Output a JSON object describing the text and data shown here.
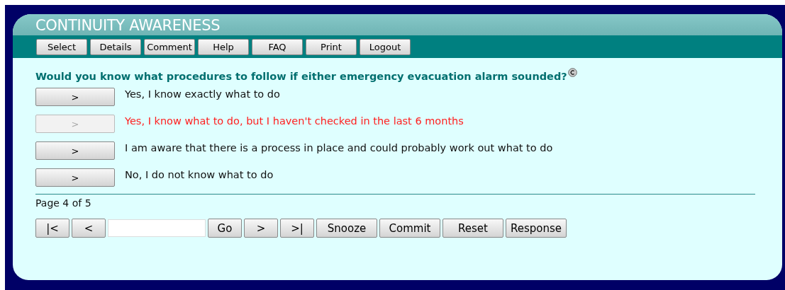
{
  "header": {
    "title": "CONTINUITY AWARENESS"
  },
  "toolbar": [
    "Select",
    "Details",
    "Comment",
    "Help",
    "FAQ",
    "Print",
    "Logout"
  ],
  "question": {
    "text": "Would you know what procedures to follow if either emergency evacuation alarm sounded?",
    "options": [
      {
        "button": ">",
        "label": "Yes, I know exactly what to do",
        "selected": false
      },
      {
        "button": ">",
        "label": "Yes, I know what to do, but I haven't checked in the last 6 months",
        "selected": true
      },
      {
        "button": ">",
        "label": "I am aware that there is a process in place and could probably work out what to do",
        "selected": false
      },
      {
        "button": ">",
        "label": "No, I do not know what to do",
        "selected": false
      }
    ]
  },
  "pager": {
    "status": "Page 4 of 5",
    "first": "|<",
    "prev": "<",
    "go": "Go",
    "next": ">",
    "last": ">|",
    "actions": [
      "Snooze",
      "Commit",
      "Reset",
      "Response"
    ]
  }
}
